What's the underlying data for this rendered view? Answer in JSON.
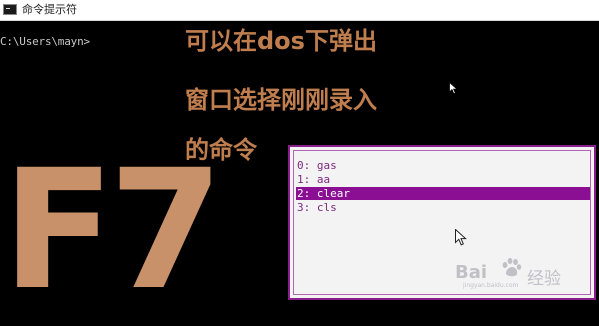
{
  "window": {
    "title": "命令提示符",
    "icon": "console-app-icon"
  },
  "console": {
    "prompt": "C:\\Users\\mayn>"
  },
  "caption": {
    "line1": "可以在dos下弹出",
    "line2": "窗口选择刚刚录入",
    "line3": "的命令"
  },
  "big_key": "F7",
  "history_popup": {
    "items": [
      "0: gas",
      "1: aa",
      "2: clear",
      "3: cls"
    ],
    "selected_index": 2
  },
  "watermark": {
    "brand": "Bai",
    "suffix": "经验",
    "url": "jingyan.baidu.com"
  },
  "colors": {
    "console_bg": "#000000",
    "caption": "#c07e4e",
    "big_key": "#c9916a",
    "popup_border": "#8a1f8c",
    "popup_bg": "#f4f3f4",
    "selection": "#8a0f92"
  }
}
